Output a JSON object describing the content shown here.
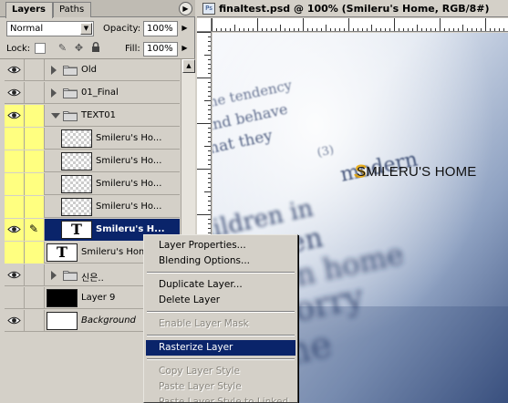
{
  "palette": {
    "tabs": [
      "Layers",
      "Paths"
    ],
    "blend_mode": "Normal",
    "opacity_label": "Opacity:",
    "opacity_value": "100%",
    "lock_label": "Lock:",
    "fill_label": "Fill:",
    "fill_value": "100%",
    "layers": [
      {
        "name": "Old",
        "kind": "group-collapsed",
        "visible": true
      },
      {
        "name": "01_Final",
        "kind": "group-collapsed",
        "visible": true
      },
      {
        "name": "TEXT01",
        "kind": "group-expanded",
        "visible": true,
        "color_tag": "yellow"
      },
      {
        "name": "Smileru's Ho...",
        "kind": "pixel",
        "visible": false,
        "color_tag": "yellow"
      },
      {
        "name": "Smileru's Ho...",
        "kind": "pixel",
        "visible": false,
        "color_tag": "yellow"
      },
      {
        "name": "Smileru's Ho...",
        "kind": "pixel",
        "visible": false,
        "color_tag": "yellow"
      },
      {
        "name": "Smileru's Ho...",
        "kind": "pixel",
        "visible": false,
        "color_tag": "yellow"
      },
      {
        "name": "Smileru's H...",
        "kind": "text",
        "visible": true,
        "selected": true,
        "color_tag": "yellow"
      },
      {
        "name": "Smileru's Home",
        "kind": "text",
        "visible": false,
        "color_tag": "yellow"
      },
      {
        "name": "신은..",
        "kind": "group-collapsed",
        "visible": true
      },
      {
        "name": "Layer 9",
        "kind": "black",
        "visible": false
      },
      {
        "name": "Background",
        "kind": "white",
        "visible": true,
        "italic": true
      }
    ]
  },
  "document": {
    "title": "finaltest.psd @ 100% (Smileru's Home, RGB/8#)",
    "overlay_logo": "SMILERU'S HOME",
    "canvas_text_lines": [
      "in the tendency",
      "ed and behave",
      "e what they",
      "(3)",
      "modern",
      "children in",
      "has been",
      "on home",
      "and worry",
      "me"
    ]
  },
  "context_menu": {
    "items": [
      {
        "label": "Layer Properties...",
        "enabled": true
      },
      {
        "label": "Blending Options...",
        "enabled": true
      },
      {
        "separator": true
      },
      {
        "label": "Duplicate Layer...",
        "enabled": true
      },
      {
        "label": "Delete Layer",
        "enabled": true
      },
      {
        "separator": true
      },
      {
        "label": "Enable Layer Mask",
        "enabled": false
      },
      {
        "separator": true
      },
      {
        "label": "Rasterize Layer",
        "enabled": true,
        "highlighted": true
      },
      {
        "separator": true
      },
      {
        "label": "Copy Layer Style",
        "enabled": false
      },
      {
        "label": "Paste Layer Style",
        "enabled": false
      },
      {
        "label": "Paste Layer Style to Linked",
        "enabled": false
      }
    ]
  },
  "colors": {
    "selection": "#0a246a",
    "color_tag_yellow": "#ffff80",
    "chrome": "#d4d0c8"
  }
}
